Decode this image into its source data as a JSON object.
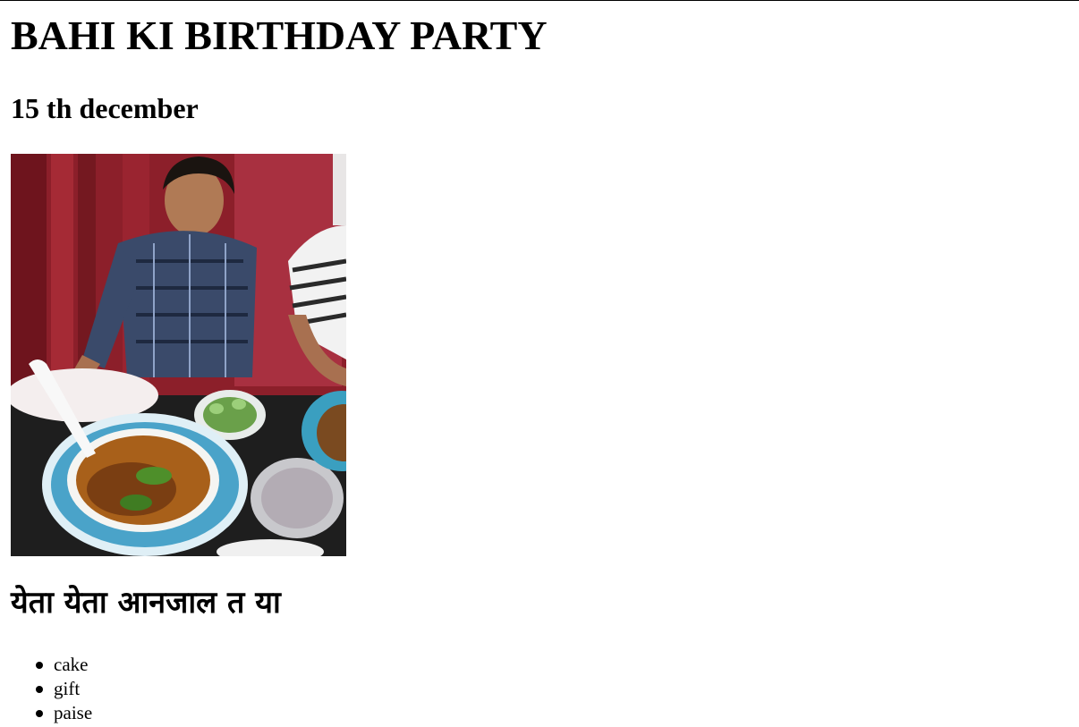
{
  "title": "BAHI KI BIRTHDAY PARTY",
  "date": "15 th december",
  "subheading": "येता येता आनजाल त या",
  "items": [
    {
      "label": "cake"
    },
    {
      "label": "gift"
    },
    {
      "label": "paise"
    }
  ],
  "photo": {
    "description_icon": "party-photo"
  }
}
